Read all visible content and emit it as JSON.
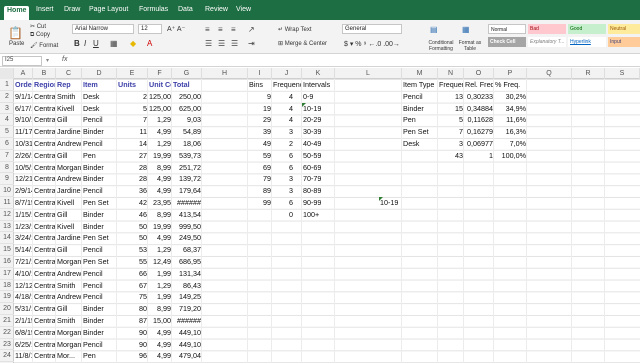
{
  "ribbon_tabs": [
    "Home",
    "Insert",
    "Draw",
    "Page Layout",
    "Formulas",
    "Data",
    "Review",
    "View"
  ],
  "ribbon": {
    "paste": "Paste",
    "cut": "Cut",
    "copy": "Copy",
    "format": "Format",
    "font_name": "Arial Narrow",
    "font_size": "12",
    "wrap_text": "Wrap Text",
    "merge_center": "Merge & Center",
    "number_format": "General",
    "conditional_formatting": "Conditional Formatting",
    "format_as_table": "Format as Table",
    "styles": [
      {
        "label": "Normal",
        "bg": "#ffffff",
        "fg": "#222222"
      },
      {
        "label": "Bad",
        "bg": "#ffc7ce",
        "fg": "#9c0006"
      },
      {
        "label": "Good",
        "bg": "#c6efce",
        "fg": "#006100"
      },
      {
        "label": "Neutral",
        "bg": "#ffeb9c",
        "fg": "#9c5700"
      },
      {
        "label": "Check Cell",
        "bg": "#a5a5a5",
        "fg": "#ffffff"
      },
      {
        "label": "Explanatory T...",
        "bg": "#ffffff",
        "fg": "#7f7f7f"
      },
      {
        "label": "Hyperlink",
        "bg": "#ffffff",
        "fg": "#0563c1"
      },
      {
        "label": "Input",
        "bg": "#ffcc99",
        "fg": "#3f3f76"
      }
    ]
  },
  "formula_bar": {
    "name_box": "I25",
    "fx": "fx"
  },
  "columns": [
    "A",
    "B",
    "C",
    "D",
    "E",
    "F",
    "G",
    "H",
    "I",
    "J",
    "K",
    "L",
    "M",
    "N",
    "O",
    "P",
    "Q",
    "R",
    "S"
  ],
  "row_numbers": [
    "1",
    "2",
    "3",
    "4",
    "5",
    "6",
    "7",
    "8",
    "9",
    "10",
    "11",
    "12",
    "13",
    "14",
    "15",
    "16",
    "17",
    "18",
    "19",
    "20",
    "21",
    "22",
    "23",
    "24"
  ],
  "data_headers": [
    "OrderDate",
    "Region",
    "Rep",
    "Item",
    "Units",
    "Unit Cost",
    "Total"
  ],
  "data_rows": [
    [
      "9/1/14",
      "Central",
      "Smith",
      "Desk",
      "2",
      "125,00",
      "250,00"
    ],
    [
      "6/17/15",
      "Central",
      "Kivell",
      "Desk",
      "5",
      "125,00",
      "625,00"
    ],
    [
      "9/10/15",
      "Central",
      "Gill",
      "Pencil",
      "7",
      "1,29",
      "9,03"
    ],
    [
      "11/17/15",
      "Central",
      "Jardine",
      "Binder",
      "11",
      "4,99",
      "54,89"
    ],
    [
      "10/31/15",
      "Central",
      "Andrews",
      "Pencil",
      "14",
      "1,29",
      "18,06"
    ],
    [
      "2/26/14",
      "Central",
      "Gill",
      "Pen",
      "27",
      "19,99",
      "539,73"
    ],
    [
      "10/5/14",
      "Central",
      "Morgan",
      "Binder",
      "28",
      "8,99",
      "251,72"
    ],
    [
      "12/21/15",
      "Central",
      "Andrews",
      "Binder",
      "28",
      "4,99",
      "139,72"
    ],
    [
      "2/9/14",
      "Central",
      "Jardine",
      "Pencil",
      "36",
      "4,99",
      "179,64"
    ],
    [
      "8/7/15",
      "Central",
      "Kivell",
      "Pen Set",
      "42",
      "23,95",
      "######"
    ],
    [
      "1/15/15",
      "Central",
      "Gill",
      "Binder",
      "46",
      "8,99",
      "413,54"
    ],
    [
      "1/23/14",
      "Central",
      "Kivell",
      "Binder",
      "50",
      "19,99",
      "999,50"
    ],
    [
      "3/24/15",
      "Central",
      "Jardine",
      "Pen Set",
      "50",
      "4,99",
      "249,50"
    ],
    [
      "5/14/15",
      "Central",
      "Gill",
      "Pencil",
      "53",
      "1,29",
      "68,37"
    ],
    [
      "7/21/15",
      "Central",
      "Morgan",
      "Pen Set",
      "55",
      "12,49",
      "686,95"
    ],
    [
      "4/10/15",
      "Central",
      "Andrews",
      "Pencil",
      "66",
      "1,99",
      "131,34"
    ],
    [
      "12/12/14",
      "Central",
      "Smith",
      "Pencil",
      "67",
      "1,29",
      "86,43"
    ],
    [
      "4/18/14",
      "Central",
      "Andrews",
      "Pencil",
      "75",
      "1,99",
      "149,25"
    ],
    [
      "5/31/15",
      "Central",
      "Gill",
      "Binder",
      "80",
      "8,99",
      "719,20"
    ],
    [
      "2/1/15",
      "Central",
      "Smith",
      "Binder",
      "87",
      "15,00",
      "######"
    ],
    [
      "6/8/15",
      "Central",
      "Morgan",
      "Binder",
      "90",
      "4,99",
      "449,10"
    ],
    [
      "6/25/14",
      "Central",
      "Morgan",
      "Pencil",
      "90",
      "4,99",
      "449,10"
    ],
    [
      "11/8/15",
      "Central",
      "Mor...",
      "Pen",
      "96",
      "4,99",
      "479,04"
    ]
  ],
  "bins_headers": [
    "Bins",
    "Frequency",
    "Intervals"
  ],
  "bins_rows": [
    [
      "9",
      "4",
      "0-9"
    ],
    [
      "19",
      "4",
      "10-19"
    ],
    [
      "29",
      "4",
      "20-29"
    ],
    [
      "39",
      "3",
      "30-39"
    ],
    [
      "49",
      "2",
      "40-49"
    ],
    [
      "59",
      "6",
      "50-59"
    ],
    [
      "69",
      "6",
      "60-69"
    ],
    [
      "79",
      "3",
      "70-79"
    ],
    [
      "89",
      "3",
      "80-89"
    ],
    [
      "99",
      "6",
      "90-99"
    ],
    [
      "",
      "0",
      "100+"
    ]
  ],
  "stray_cell_k11": "10-19",
  "freq_headers": [
    "Item Type",
    "Frequency",
    "Rel. Freq.",
    "% Freq."
  ],
  "freq_rows": [
    [
      "Pencil",
      "13",
      "0,30233",
      "30,2%"
    ],
    [
      "Binder",
      "15",
      "0,34884",
      "34,9%"
    ],
    [
      "Pen",
      "5",
      "0,11628",
      "11,6%"
    ],
    [
      "Pen Set",
      "7",
      "0,16279",
      "16,3%"
    ],
    [
      "Desk",
      "3",
      "0,06977",
      "7,0%"
    ]
  ],
  "freq_total": [
    "43",
    "1",
    "100,0%"
  ]
}
